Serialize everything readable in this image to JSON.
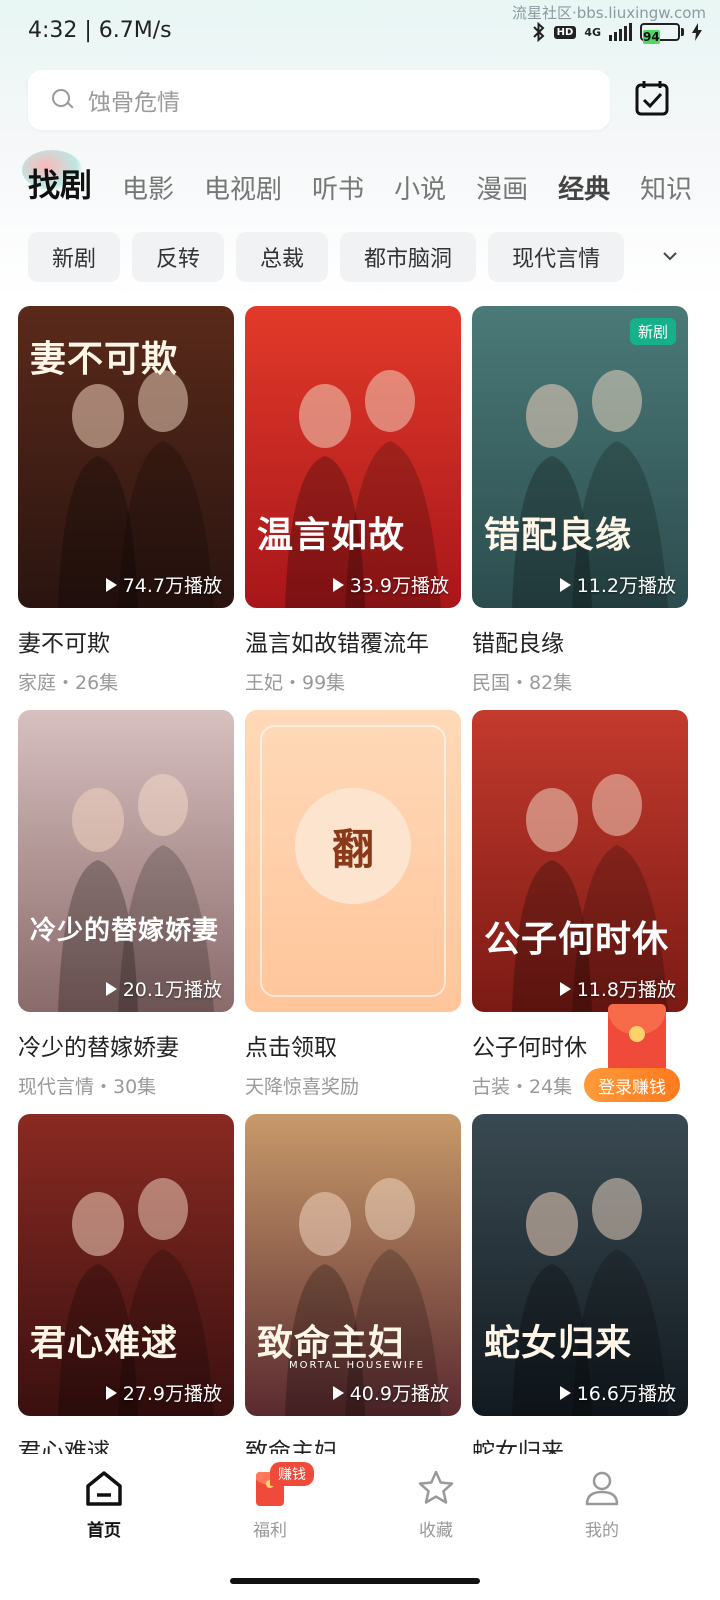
{
  "status_bar": {
    "time": "4:32 | 6.7M/s",
    "watermark": "流星社区·bbs.liuxingw.com",
    "hd": "HD",
    "network": "4G",
    "battery": "94"
  },
  "search": {
    "placeholder": "蚀骨危情"
  },
  "tabs": [
    "找剧",
    "电影",
    "电视剧",
    "听书",
    "小说",
    "漫画",
    "经典",
    "知识"
  ],
  "chips": [
    "新剧",
    "反转",
    "总裁",
    "都市脑洞",
    "现代言情"
  ],
  "cards": [
    {
      "title": "妻不可欺",
      "meta": "家庭・26集",
      "plays": "74.7万播放",
      "poster_text": "妻不可欺",
      "colors": [
        "#5a2a1a",
        "#2a1410"
      ]
    },
    {
      "title": "温言如故错覆流年",
      "meta": "王妃・99集",
      "plays": "33.9万播放",
      "poster_text": "温言如故",
      "colors": [
        "#e23a2a",
        "#a8161a"
      ]
    },
    {
      "title": "错配良缘",
      "meta": "民国・82集",
      "plays": "11.2万播放",
      "poster_text": "错配良缘",
      "badge": "新剧",
      "colors": [
        "#4a7a78",
        "#2c4c4e"
      ]
    },
    {
      "title": "冷少的替嫁娇妻",
      "meta": "现代言情・30集",
      "plays": "20.1万播放",
      "poster_text": "冷少的替嫁娇妻",
      "colors": [
        "#d8c0c0",
        "#8a6a6a"
      ]
    },
    {
      "title": "点击领取",
      "meta": "天降惊喜奖励",
      "flip": "翻",
      "colors": [
        "#ffd9b8",
        "#ffc59a"
      ]
    },
    {
      "title": "公子何时休",
      "meta": "古装・24集",
      "plays": "11.8万播放",
      "poster_text": "公子何时休",
      "colors": [
        "#c43a2e",
        "#7a1a14"
      ]
    },
    {
      "title": "君心难逑",
      "meta": "",
      "plays": "27.9万播放",
      "poster_text": "君心难逑",
      "colors": [
        "#8a2a22",
        "#3a1010"
      ]
    },
    {
      "title": "致命主妇",
      "meta": "",
      "plays": "40.9万播放",
      "poster_text": "致命主妇",
      "poster_sub": "MORTAL HOUSEWIFE",
      "colors": [
        "#c89a6a",
        "#5a2a30"
      ]
    },
    {
      "title": "蛇女归来",
      "meta": "",
      "plays": "16.6万播放",
      "poster_text": "蛇女归来",
      "colors": [
        "#3a4a52",
        "#121a20"
      ]
    }
  ],
  "floating": {
    "label": "登录赚钱"
  },
  "bottom_nav": [
    {
      "label": "首页",
      "icon": "home-icon",
      "active": true
    },
    {
      "label": "福利",
      "icon": "gift-icon",
      "badge": "赚钱"
    },
    {
      "label": "收藏",
      "icon": "star-icon"
    },
    {
      "label": "我的",
      "icon": "user-icon"
    }
  ],
  "accent_colors": {
    "badge_green": "#16b08a",
    "earn_red": "#f04a3a",
    "earn_orange": "#ff8a2a"
  }
}
